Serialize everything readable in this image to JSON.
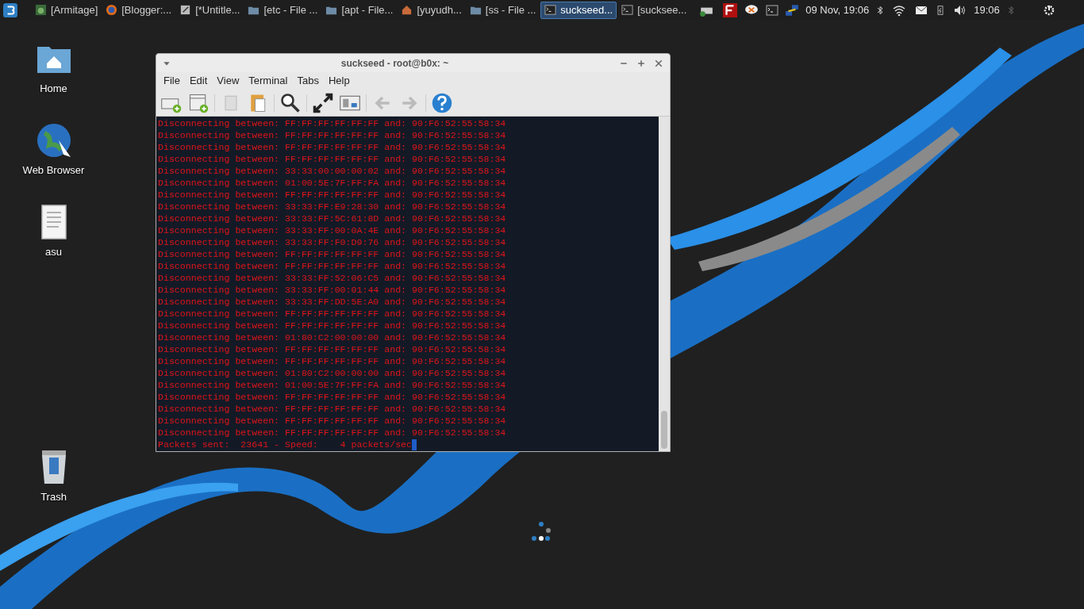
{
  "taskbar": {
    "tasks": [
      {
        "label": "[Armitage]",
        "kind": "image",
        "selected": false
      },
      {
        "label": "[Blogger:...",
        "kind": "browser",
        "selected": false
      },
      {
        "label": "[*Untitle...",
        "kind": "editor",
        "selected": false
      },
      {
        "label": "[etc - File ...",
        "kind": "folder",
        "selected": false
      },
      {
        "label": "[apt - File...",
        "kind": "folder",
        "selected": false
      },
      {
        "label": "[yuyudh...",
        "kind": "home",
        "selected": false
      },
      {
        "label": "[ss - File ...",
        "kind": "folder",
        "selected": false
      },
      {
        "label": "suckseed...",
        "kind": "terminal",
        "selected": true
      },
      {
        "label": "[sucksee...",
        "kind": "terminal",
        "selected": false
      }
    ],
    "date": "09 Nov, 19:06",
    "clock": "19:06"
  },
  "desktop_icons": [
    {
      "label": "Home",
      "kind": "folder"
    },
    {
      "label": "Web Browser",
      "kind": "browser"
    },
    {
      "label": "asu",
      "kind": "file"
    },
    {
      "label": "Trash",
      "kind": "trash"
    }
  ],
  "window": {
    "title": "suckseed - root@b0x: ~",
    "menu": [
      "File",
      "Edit",
      "View",
      "Terminal",
      "Tabs",
      "Help"
    ],
    "terminal": {
      "lines": [
        "Disconnecting between: FF:FF:FF:FF:FF:FF and: 90:F6:52:55:58:34",
        "Disconnecting between: FF:FF:FF:FF:FF:FF and: 90:F6:52:55:58:34",
        "Disconnecting between: FF:FF:FF:FF:FF:FF and: 90:F6:52:55:58:34",
        "Disconnecting between: FF:FF:FF:FF:FF:FF and: 90:F6:52:55:58:34",
        "Disconnecting between: 33:33:00:00:00:02 and: 90:F6:52:55:58:34",
        "Disconnecting between: 01:00:5E:7F:FF:FA and: 90:F6:52:55:58:34",
        "Disconnecting between: FF:FF:FF:FF:FF:FF and: 90:F6:52:55:58:34",
        "Disconnecting between: 33:33:FF:E9:28:30 and: 90:F6:52:55:58:34",
        "Disconnecting between: 33:33:FF:5C:61:8D and: 90:F6:52:55:58:34",
        "Disconnecting between: 33:33:FF:00:0A:4E and: 90:F6:52:55:58:34",
        "Disconnecting between: 33:33:FF:F0:D9:76 and: 90:F6:52:55:58:34",
        "Disconnecting between: FF:FF:FF:FF:FF:FF and: 90:F6:52:55:58:34",
        "Disconnecting between: FF:FF:FF:FF:FF:FF and: 90:F6:52:55:58:34",
        "Disconnecting between: 33:33:FF:52:06:C5 and: 90:F6:52:55:58:34",
        "Disconnecting between: 33:33:FF:00:01:44 and: 90:F6:52:55:58:34",
        "Disconnecting between: 33:33:FF:DD:5E:A0 and: 90:F6:52:55:58:34",
        "Disconnecting between: FF:FF:FF:FF:FF:FF and: 90:F6:52:55:58:34",
        "Disconnecting between: FF:FF:FF:FF:FF:FF and: 90:F6:52:55:58:34",
        "Disconnecting between: 01:80:C2:00:00:00 and: 90:F6:52:55:58:34",
        "Disconnecting between: FF:FF:FF:FF:FF:FF and: 90:F6:52:55:58:34",
        "Disconnecting between: FF:FF:FF:FF:FF:FF and: 90:F6:52:55:58:34",
        "Disconnecting between: 01:80:C2:00:00:00 and: 90:F6:52:55:58:34",
        "Disconnecting between: 01:00:5E:7F:FF:FA and: 90:F6:52:55:58:34",
        "Disconnecting between: FF:FF:FF:FF:FF:FF and: 90:F6:52:55:58:34",
        "Disconnecting between: FF:FF:FF:FF:FF:FF and: 90:F6:52:55:58:34",
        "Disconnecting between: FF:FF:FF:FF:FF:FF and: 90:F6:52:55:58:34",
        "Disconnecting between: FF:FF:FF:FF:FF:FF and: 90:F6:52:55:58:34"
      ],
      "status_line": "Packets sent:  23641 - Speed:    4 packets/sec"
    }
  }
}
